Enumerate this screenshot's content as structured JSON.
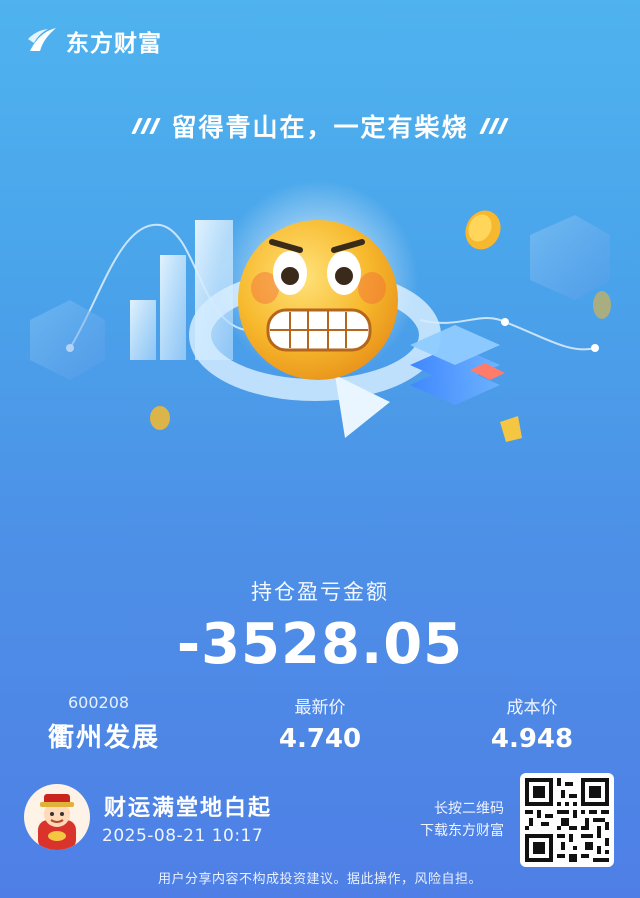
{
  "brand": {
    "name": "东方财富"
  },
  "slogan": "留得青山在，一定有柴烧",
  "pnl": {
    "label": "持仓盈亏金额",
    "value": "-3528.05"
  },
  "stock": {
    "code": "600208",
    "name": "衢州发展",
    "latest_price_label": "最新价",
    "latest_price": "4.740",
    "cost_price_label": "成本价",
    "cost_price": "4.948"
  },
  "share": {
    "blessing": "财运满堂地白起",
    "datetime": "2025-08-21 10:17",
    "download_line1": "长按二维码",
    "download_line2": "下载东方财富"
  },
  "disclaimer": "用户分享内容不构成投资建议。据此操作，风险自担。",
  "colors": {
    "background_top": "#4fb3ef",
    "background_bottom": "#4f7fe6",
    "text": "#ffffff",
    "emoji": "#f5b82e"
  },
  "icons": [
    "logo-icon",
    "grimacing-emoji-icon",
    "fortune-god-avatar-icon",
    "qr-code"
  ]
}
